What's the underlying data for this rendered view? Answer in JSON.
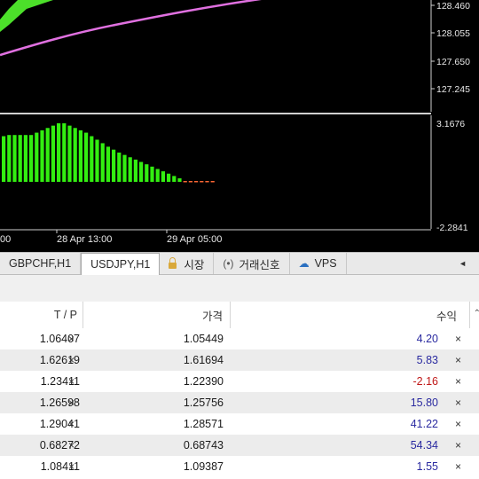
{
  "price_axis": {
    "labels": [
      "128.460",
      "128.055",
      "127.650",
      "127.245"
    ]
  },
  "indicator_axis": {
    "labels": [
      "3.1676",
      "-2.2841"
    ]
  },
  "time_axis": {
    "labels": [
      "00",
      "28 Apr 13:00",
      "29 Apr 05:00"
    ]
  },
  "histogram": {
    "values": [
      0.78,
      0.8,
      0.8,
      0.8,
      0.8,
      0.8,
      0.84,
      0.88,
      0.92,
      0.96,
      1.0,
      1.0,
      0.96,
      0.92,
      0.88,
      0.84,
      0.78,
      0.72,
      0.66,
      0.6,
      0.55,
      0.5,
      0.46,
      0.42,
      0.38,
      0.34,
      0.3,
      0.26,
      0.22,
      0.18,
      0.14,
      0.1,
      0.06
    ],
    "tail_values": [
      0.02,
      0.02,
      0.02,
      0.02,
      0.02,
      0.02
    ],
    "bar_color": "#33ee11",
    "tail_color": "#ff6633"
  },
  "colors": {
    "ma_line": "#e070e0",
    "band": "#4ce02a",
    "accent_text": "#2a2aa0",
    "negative_text": "#c01818"
  },
  "tabs": [
    {
      "label": "GBPCHF,H1",
      "active": false,
      "icon": ""
    },
    {
      "label": "USDJPY,H1",
      "active": true,
      "icon": ""
    },
    {
      "label": "시장",
      "active": false,
      "icon": "lock-icon"
    },
    {
      "label": "거래신호",
      "active": false,
      "icon": "signal-icon"
    },
    {
      "label": "VPS",
      "active": false,
      "icon": "cloud-icon"
    }
  ],
  "table": {
    "headers": {
      "tp": "T / P",
      "price": "가격",
      "profit": "수익"
    },
    "rows": [
      {
        "tp": "1.06407",
        "price": "1.05449",
        "profit": "4.20"
      },
      {
        "tp": "1.62619",
        "price": "1.61694",
        "profit": "5.83"
      },
      {
        "tp": "1.23411",
        "price": "1.22390",
        "profit": "-2.16"
      },
      {
        "tp": "1.26598",
        "price": "1.25756",
        "profit": "15.80"
      },
      {
        "tp": "1.29041",
        "price": "1.28571",
        "profit": "41.22"
      },
      {
        "tp": "0.68272",
        "price": "0.68743",
        "profit": "54.34"
      },
      {
        "tp": "1.08411",
        "price": "1.09387",
        "profit": "1.55"
      }
    ],
    "close_glyph": "×"
  }
}
